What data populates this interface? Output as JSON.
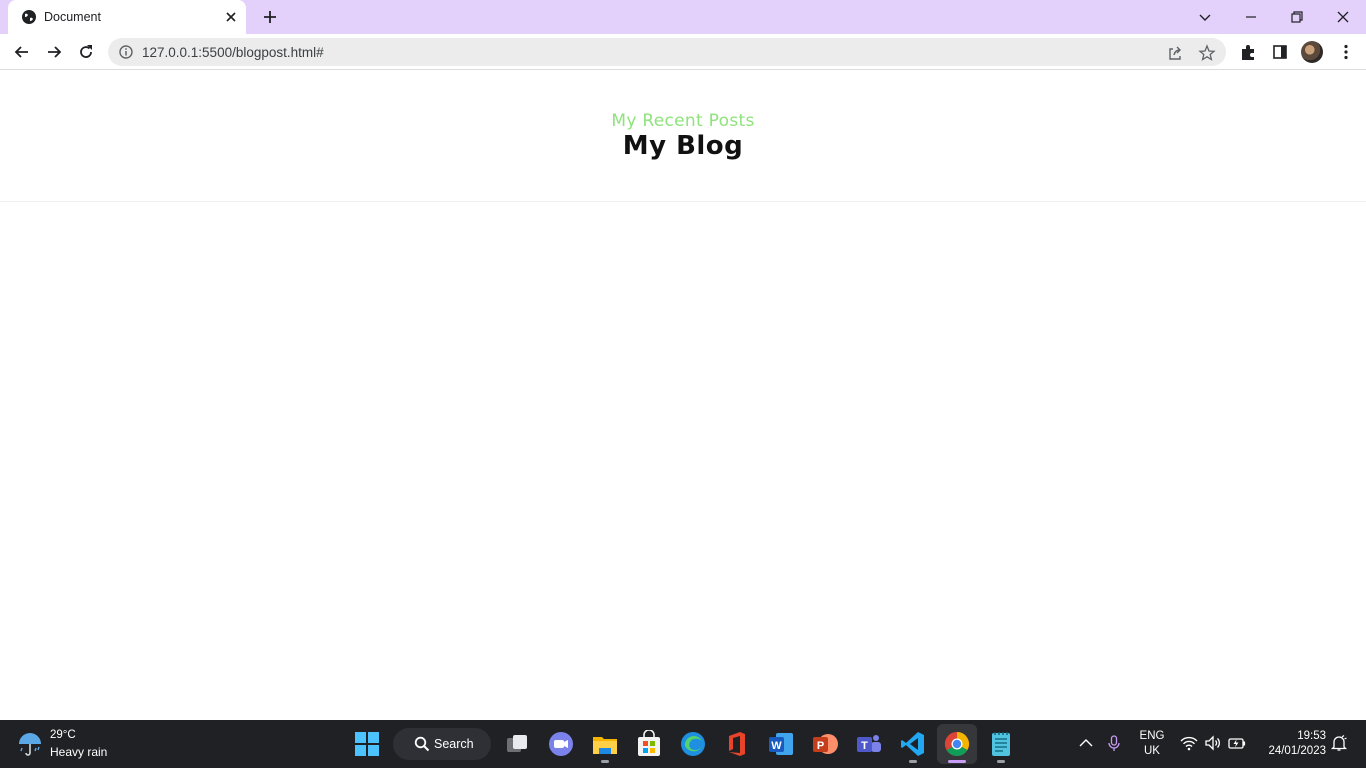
{
  "browser": {
    "tab_title": "Document",
    "url": "127.0.0.1:5500/blogpost.html#"
  },
  "page": {
    "subtitle": "My Recent Posts",
    "title": "My Blog"
  },
  "taskbar": {
    "weather_temp": "29°C",
    "weather_desc": "Heavy rain",
    "search_label": "Search",
    "lang_line1": "ENG",
    "lang_line2": "UK",
    "time": "19:53",
    "date": "24/01/2023"
  },
  "colors": {
    "tab_strip": "#e3d1fb",
    "subtitle": "#8ee37b",
    "title": "#111111",
    "taskbar": "#202124"
  },
  "icons": {
    "taskbar_apps": [
      "windows-start-icon",
      "search-icon",
      "task-view-icon",
      "teams-chat-icon",
      "file-explorer-icon",
      "microsoft-store-icon",
      "edge-icon",
      "office-icon",
      "word-icon",
      "powerpoint-icon",
      "teams-icon",
      "vscode-icon",
      "chrome-icon",
      "notepad-icon"
    ],
    "tray": [
      "chevron-up-icon",
      "microphone-icon",
      "wifi-icon",
      "volume-icon",
      "battery-icon",
      "notification-icon"
    ]
  }
}
